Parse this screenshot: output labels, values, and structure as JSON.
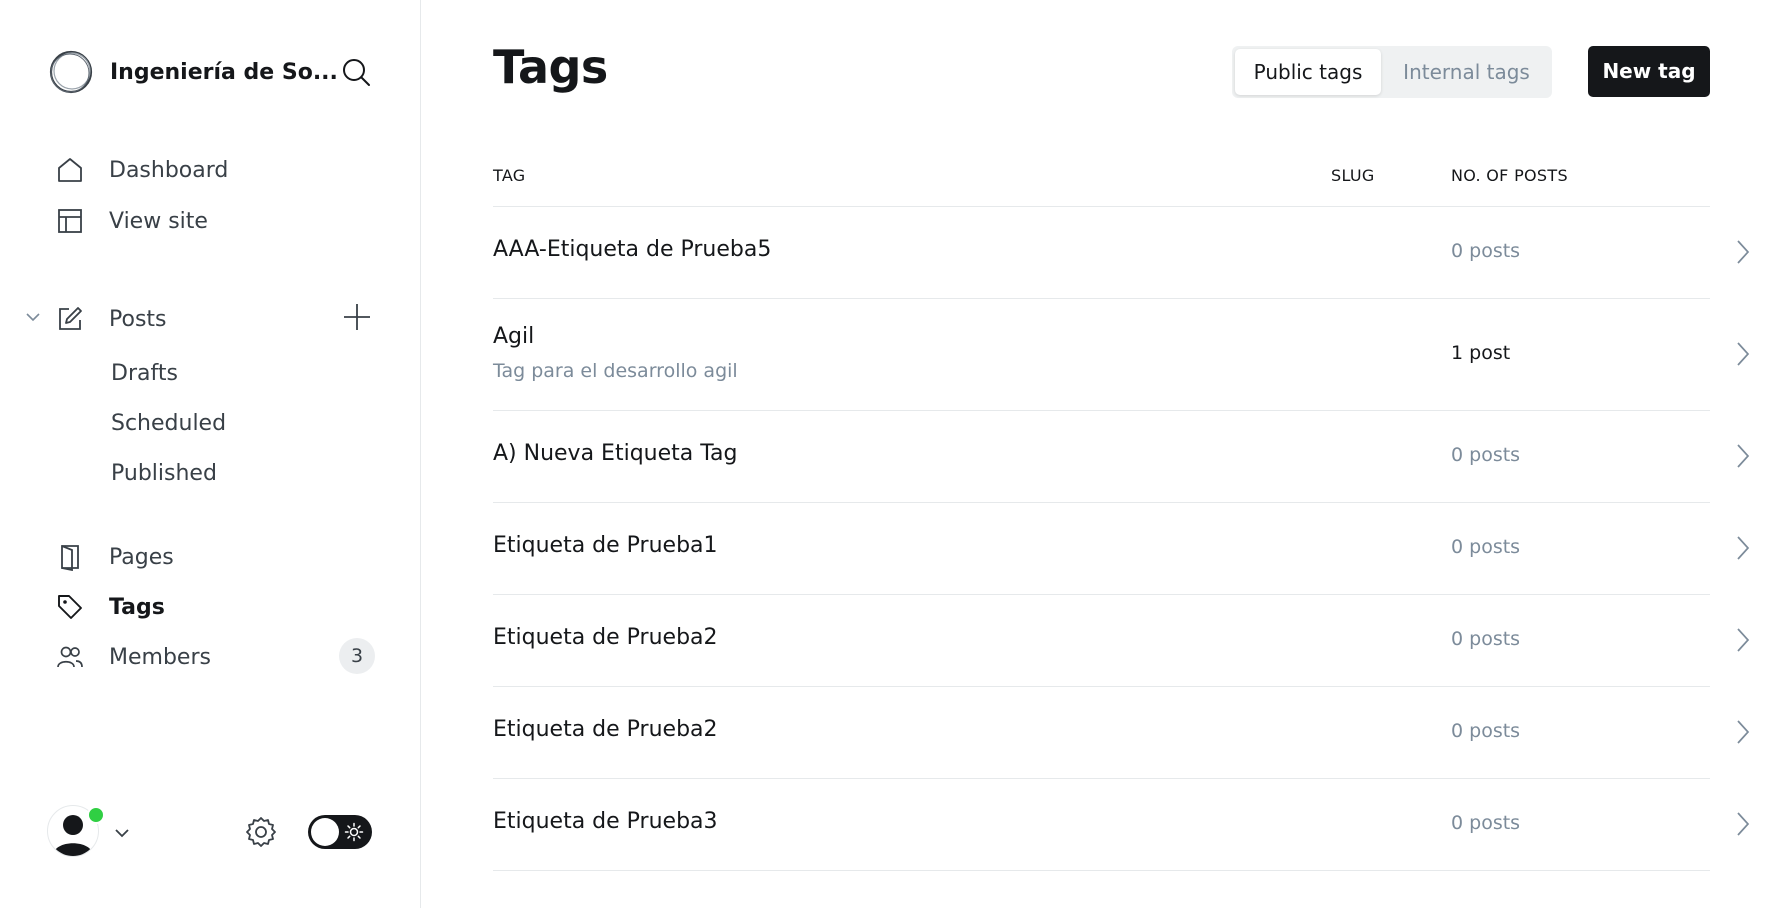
{
  "sidebar": {
    "site_name": "Ingeniería de So...",
    "nav": {
      "dashboard": "Dashboard",
      "view_site": "View site",
      "posts": "Posts",
      "drafts": "Drafts",
      "scheduled": "Scheduled",
      "published": "Published",
      "pages": "Pages",
      "tags": "Tags",
      "members": "Members",
      "members_count": "3"
    }
  },
  "header": {
    "title": "Tags",
    "public_tab": "Public tags",
    "internal_tab": "Internal tags",
    "new_tag": "New tag"
  },
  "table": {
    "columns": {
      "tag": "TAG",
      "slug": "SLUG",
      "posts": "NO. OF POSTS"
    },
    "rows": [
      {
        "name": "AAA-Etiqueta de Prueba5",
        "description": "",
        "posts": "0 posts"
      },
      {
        "name": "Agil",
        "description": "Tag para el desarrollo agil",
        "posts": "1 post"
      },
      {
        "name": "A) Nueva Etiqueta Tag",
        "description": "",
        "posts": "0 posts"
      },
      {
        "name": "Etiqueta de Prueba1",
        "description": "",
        "posts": "0 posts"
      },
      {
        "name": "Etiqueta de Prueba2",
        "description": "",
        "posts": "0 posts"
      },
      {
        "name": "Etiqueta de Prueba2",
        "description": "",
        "posts": "0 posts"
      },
      {
        "name": "Etiqueta de Prueba3",
        "description": "",
        "posts": "0 posts"
      }
    ]
  },
  "colors": {
    "accent": "#15171a",
    "muted": "#7c8b9a",
    "online": "#30cf43"
  },
  "icons": [
    "logo-icon",
    "search-icon",
    "home-icon",
    "layout-icon",
    "chevron-down-icon",
    "edit-icon",
    "plus-icon",
    "pages-icon",
    "tag-icon",
    "members-icon",
    "gear-icon",
    "sun-icon",
    "chevron-right-icon"
  ]
}
